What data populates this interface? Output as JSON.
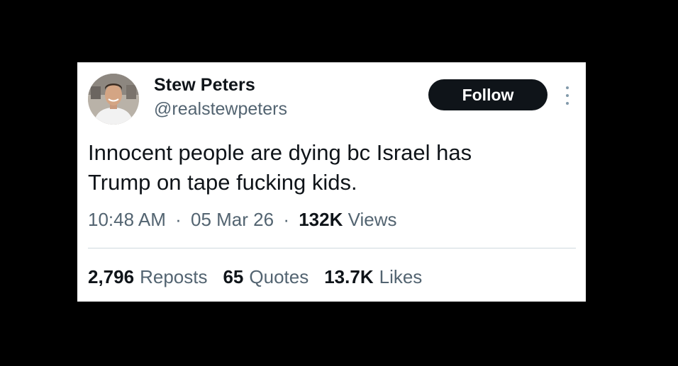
{
  "tweet": {
    "author": {
      "display_name": "Stew Peters",
      "handle": "@realstewpeters"
    },
    "follow_label": "Follow",
    "text_line1": "Innocent people are dying bc Israel has",
    "text_line2": "Trump on tape fucking kids.",
    "time": "10:48 AM",
    "date": "05 Mar 26",
    "separator": "·",
    "views_count": "132K",
    "views_label": "Views",
    "stats": {
      "reposts_count": "2,796",
      "reposts_label": "Reposts",
      "quotes_count": "65",
      "quotes_label": "Quotes",
      "likes_count": "13.7K",
      "likes_label": "Likes"
    }
  },
  "colors": {
    "page_background": "#000000",
    "card_background": "#ffffff",
    "primary_text": "#0f1419",
    "secondary_text": "#536471",
    "divider": "#cfd9de",
    "follow_button": "#0f1419"
  },
  "icons": {
    "more": "more-vertical-icon"
  }
}
